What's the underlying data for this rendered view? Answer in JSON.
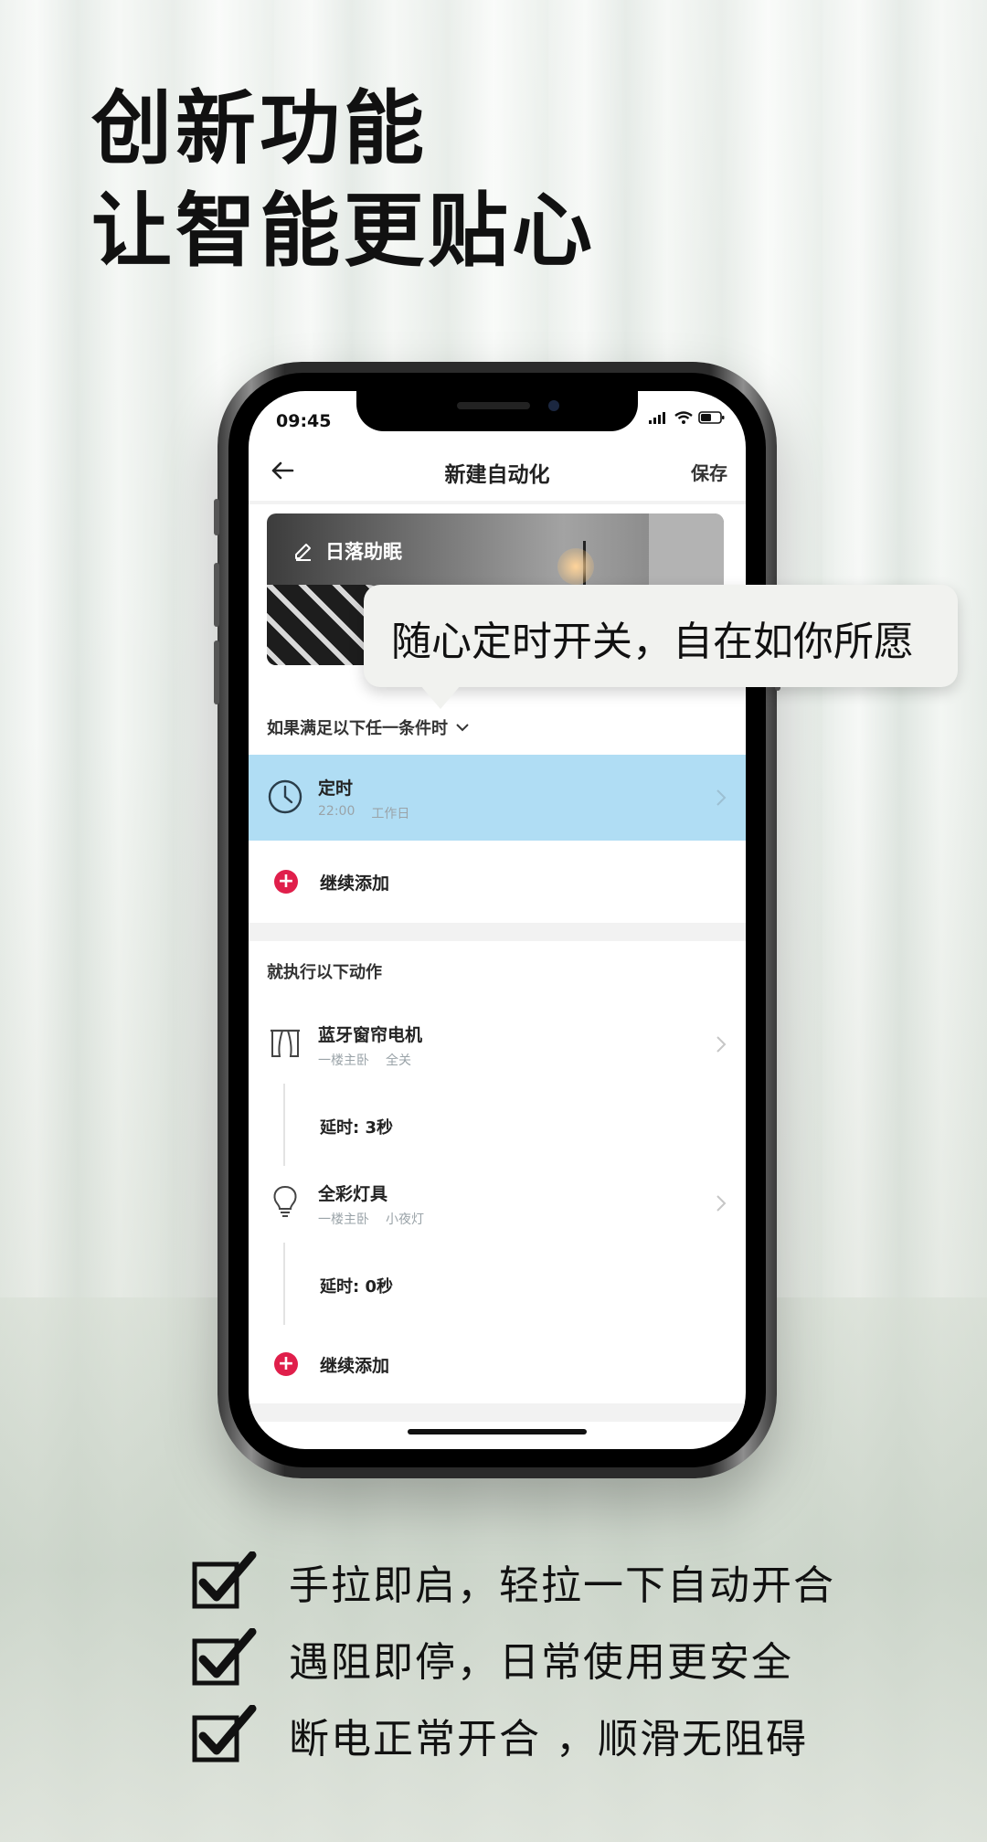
{
  "headline": {
    "line1": "创新功能",
    "line2": "让智能更贴心"
  },
  "status_bar": {
    "time": "09:45"
  },
  "nav": {
    "title": "新建自动化",
    "save_label": "保存"
  },
  "banner": {
    "scene_name": "日落助眠"
  },
  "bubble_text": "随心定时开关，自在如你所愿",
  "conditions": {
    "label": "如果满足以下任一条件时",
    "timer": {
      "title": "定时",
      "time": "22:00",
      "days": "工作日"
    },
    "add_label": "继续添加"
  },
  "actions": {
    "label": "就执行以下动作",
    "items": [
      {
        "name": "蓝牙窗帘电机",
        "room": "一楼主卧",
        "state": "全关",
        "delay": "延时: 3秒"
      },
      {
        "name": "全彩灯具",
        "room": "一楼主卧",
        "state": "小夜灯",
        "delay": "延时: 0秒"
      }
    ],
    "add_label": "继续添加"
  },
  "features": [
    "手拉即启，轻拉一下自动开合",
    "遇阻即停，日常使用更安全",
    "断电正常开合 ，顺滑无阻碍"
  ],
  "colors": {
    "accent_red": "#e01f4b",
    "highlight_blue": "#b0ddf4"
  }
}
